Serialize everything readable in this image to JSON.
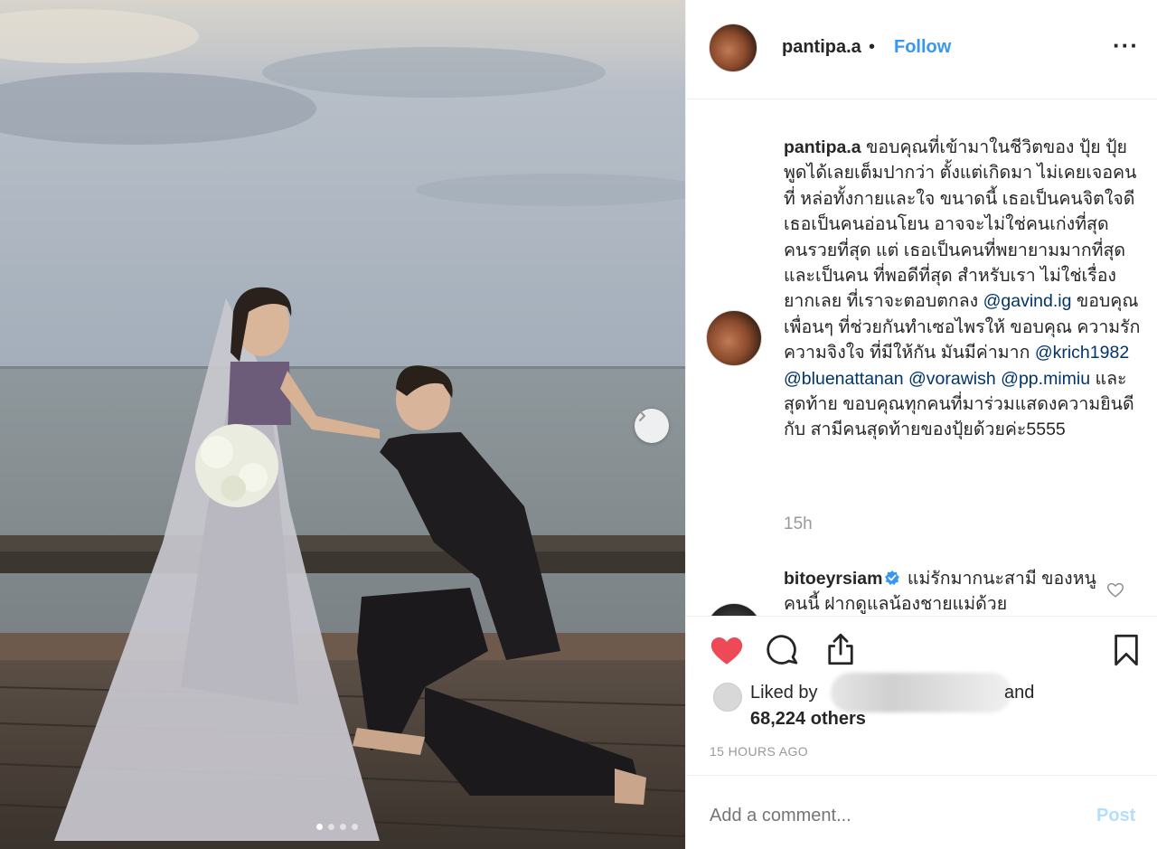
{
  "post": {
    "username": "pantipa.a",
    "separator": "•",
    "follow_label": "Follow",
    "more_label": "···",
    "caption": {
      "username": "pantipa.a",
      "segments": [
        {
          "type": "text",
          "value": " ขอบคุณที่เข้ามาในชีวิตของ ปุ้ย ปุ้ยพูดได้เลยเต็มปากว่า ตั้งแต่เกิดมา ไม่เคยเจอคนที่ หล่อทั้งกายและใจ ขนาดนี้ เธอเป็นคนจิตใจดี เธอเป็นคนอ่อนโยน อาจจะไม่ใช่คนเก่งที่สุด คนรวยที่สุด แต่ เธอเป็นคนที่พยายามมากที่สุดและเป็นคน ที่พอดีที่สุด สำหรับเรา ไม่ใช่เรื่องยากเลย ที่เราจะตอบตกลง "
        },
        {
          "type": "mention",
          "value": "@gavind.ig"
        },
        {
          "type": "text",
          "value": " ขอบคุณ เพื่อนๆ ที่ช่วยกันทำเซอไพรให้ ขอบคุณ ความรัก ความจิงใจ ที่มีให้กัน มันมีค่ามาก "
        },
        {
          "type": "mention",
          "value": "@krich1982"
        },
        {
          "type": "text",
          "value": " "
        },
        {
          "type": "mention",
          "value": "@bluenattanan"
        },
        {
          "type": "text",
          "value": " "
        },
        {
          "type": "mention",
          "value": "@vorawish"
        },
        {
          "type": "text",
          "value": " "
        },
        {
          "type": "mention",
          "value": "@pp.mimiu"
        },
        {
          "type": "text",
          "value": " และสุดท้าย ขอบคุณทุกคนที่มาร่วมแสดงความยินดีกับ สามีคนสุดท้ายของปุ้ยด้วยค่ะ5555"
        }
      ],
      "time": "15h"
    },
    "comment": {
      "username": "bitoeyrsiam",
      "text": " แม่รักมากนะสามี ของหนูคนนี้ ฝากดูแลน้องชายแม่ด้วย"
    },
    "likes": {
      "prefix": "Liked by",
      "suffix": "and",
      "count_text": "68,224 others"
    },
    "time_ago": "15 HOURS AGO",
    "add_comment_placeholder": "Add a comment...",
    "post_label": "Post"
  },
  "carousel": {
    "slides": 4,
    "active_index": 0
  },
  "icons": {
    "like": "heart-filled-icon",
    "comment": "comment-bubble-icon",
    "share": "share-icon",
    "save": "bookmark-icon",
    "next": "chevron-right-icon",
    "verified": "verified-badge-icon"
  },
  "colors": {
    "like_red": "#ed4956",
    "link_blue": "#3897f0",
    "mention_blue": "#003569",
    "muted": "#999999",
    "post_disabled": "#b2dffc"
  }
}
